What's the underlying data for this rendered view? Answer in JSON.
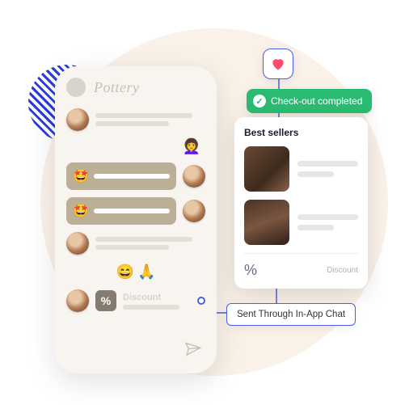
{
  "phone": {
    "brand": "Pottery",
    "emoji_reply": "👩‍🦱",
    "filled_emoji": "🤩",
    "reactions": [
      "😄",
      "🙏"
    ],
    "discount": {
      "symbol": "%",
      "label": "Discount"
    },
    "send_icon": "send"
  },
  "heart": {
    "icon": "heart"
  },
  "checkout": {
    "check": "✓",
    "text": "Check-out completed"
  },
  "card": {
    "title": "Best sellers",
    "footer": {
      "symbol": "%",
      "label": "Discount"
    }
  },
  "label": {
    "text": "Sent Through In-App Chat"
  }
}
